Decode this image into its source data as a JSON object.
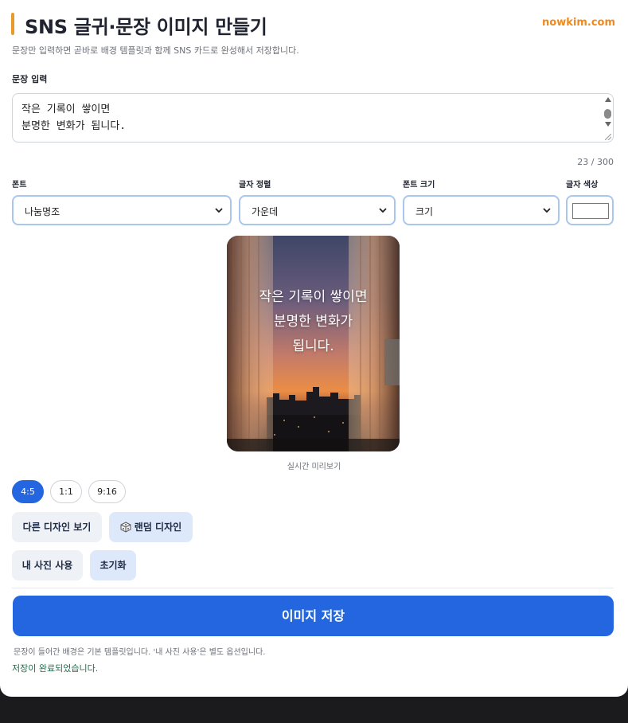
{
  "header": {
    "title": "SNS 글귀·문장 이미지 만들기",
    "brand": "nowkim.com",
    "subtitle": "문장만 입력하면 곧바로 배경 템플릿과 함께 SNS 카드로 완성해서 저장합니다."
  },
  "input": {
    "label": "문장 입력",
    "value": "작은 기록이 쌓이면\n분명한 변화가 됩니다.",
    "counter": "23 / 300"
  },
  "controls": {
    "font": {
      "label": "폰트",
      "value": "나눔명조"
    },
    "align": {
      "label": "글자 정렬",
      "value": "가운데"
    },
    "size": {
      "label": "폰트 크기",
      "value": "크기"
    },
    "color": {
      "label": "글자 색상",
      "value": "#ffffff"
    }
  },
  "preview": {
    "lines": [
      "작은 기록이 쌓이면",
      "분명한 변화가",
      "됩니다."
    ],
    "caption": "실시간 미리보기"
  },
  "ratios": [
    {
      "label": "4:5",
      "active": true
    },
    {
      "label": "1:1",
      "active": false
    },
    {
      "label": "9:16",
      "active": false
    }
  ],
  "buttons": {
    "other_design": "다른 디자인 보기",
    "random_design": "랜덤 디자인",
    "my_photo": "내 사진 사용",
    "reset": "초기화",
    "save": "이미지 저장"
  },
  "footer": {
    "note": "문장이 들어간 배경은 기본 템플릿입니다. '내 사진 사용'은 별도 옵션입니다.",
    "status": "저장이 완료되었습니다."
  },
  "colors": {
    "accent": "#2466df",
    "brand": "#f08a1c",
    "title_bar": "#e89a2c",
    "status": "#1f6e4c"
  }
}
